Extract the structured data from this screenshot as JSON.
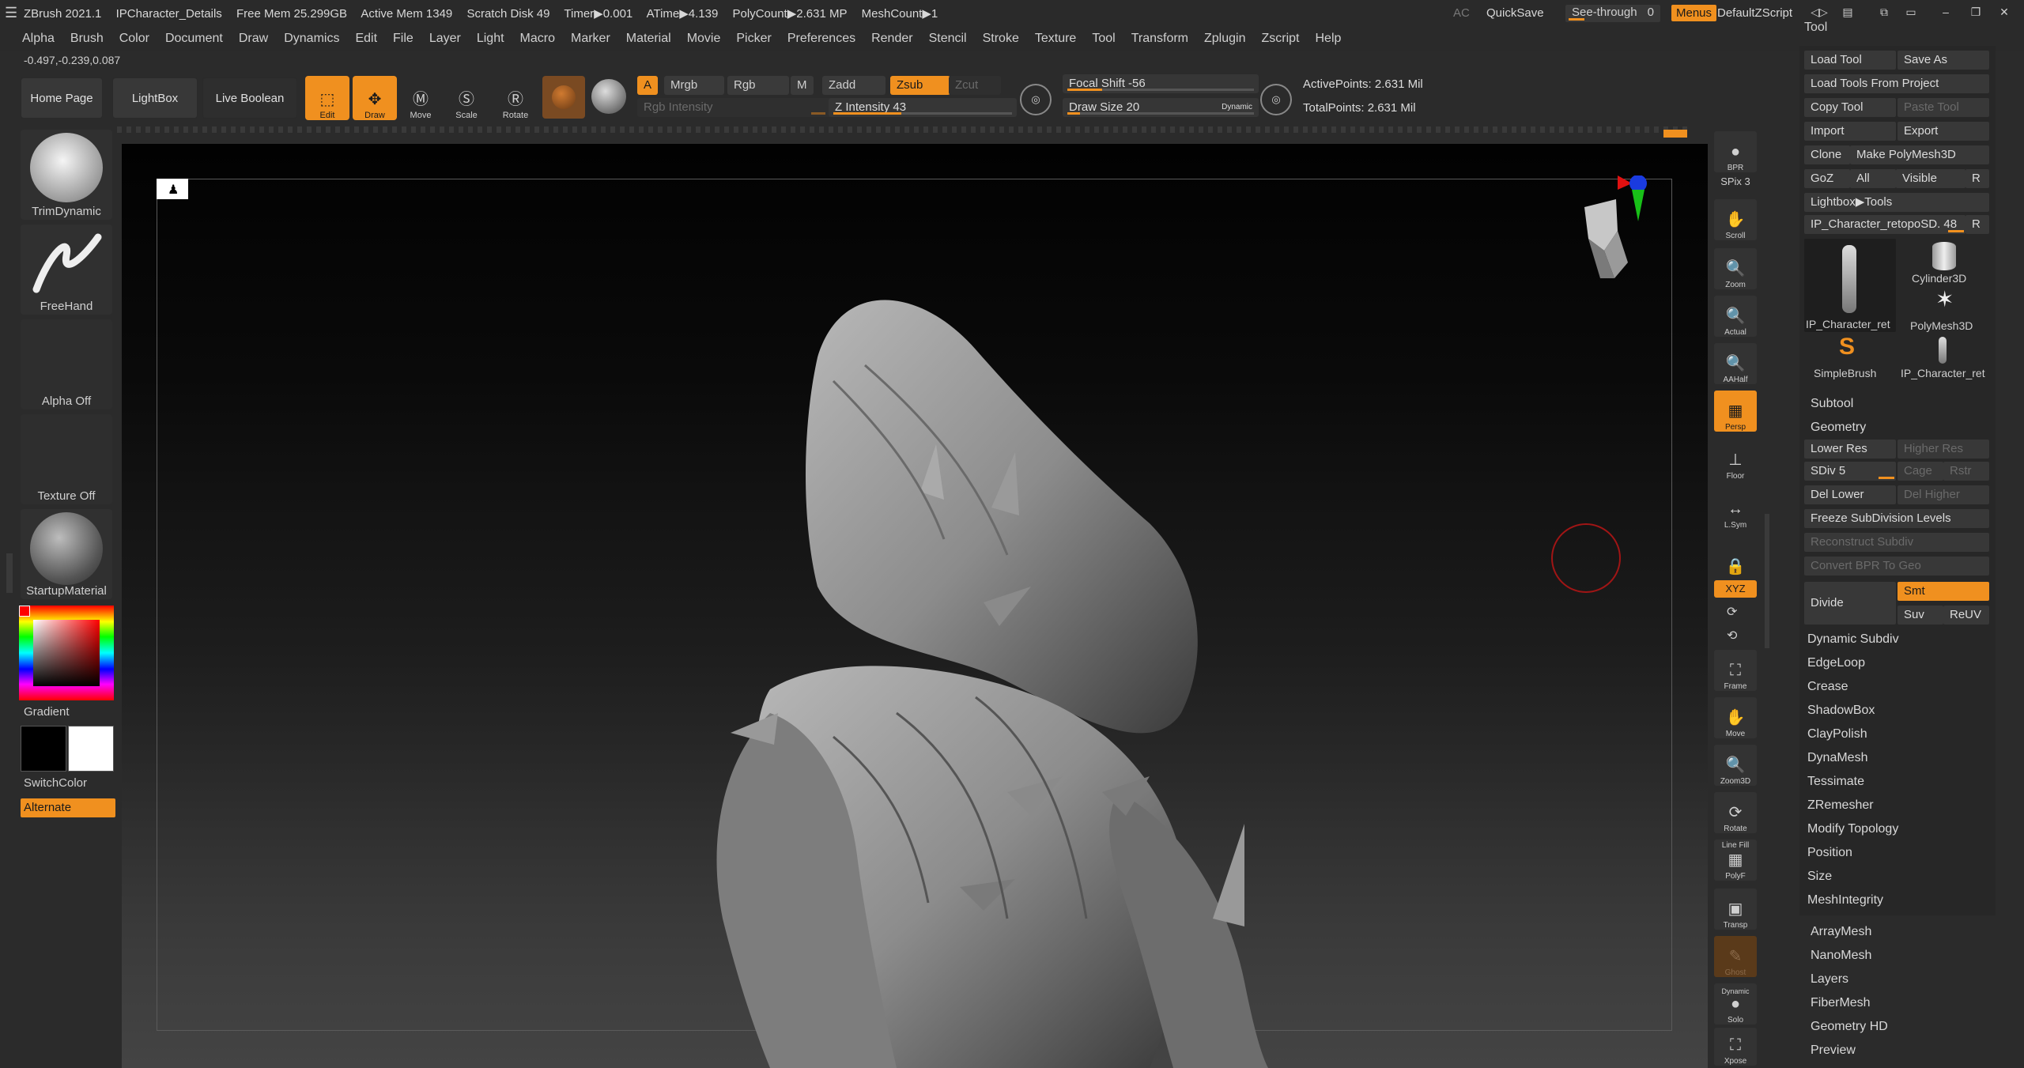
{
  "titlebar": {
    "app": "ZBrush 2021.1",
    "doc": "IPCharacter_Details",
    "free_mem": "Free Mem 25.299GB",
    "active_mem": "Active Mem 1349",
    "scratch": "Scratch Disk 49",
    "timer": "Timer▶0.001",
    "atime": "ATime▶4.139",
    "polycount": "PolyCount▶2.631 MP",
    "meshcount": "MeshCount▶1",
    "ac": "AC",
    "quicksave": "QuickSave",
    "seethrough": "See-through",
    "seethrough_value": "0",
    "menus": "Menus",
    "script": "DefaultZScript"
  },
  "menubar": [
    "Alpha",
    "Brush",
    "Color",
    "Document",
    "Draw",
    "Dynamics",
    "Edit",
    "File",
    "Layer",
    "Light",
    "Macro",
    "Marker",
    "Material",
    "Movie",
    "Picker",
    "Preferences",
    "Render",
    "Stencil",
    "Stroke",
    "Texture",
    "Tool",
    "Transform",
    "Zplugin",
    "Zscript",
    "Help"
  ],
  "coords": "-0.497,-0.239,0.087",
  "toolbar": {
    "home": "Home Page",
    "lightbox": "LightBox",
    "live_boolean": "Live Boolean",
    "edit": "Edit",
    "draw": "Draw",
    "move": "Move",
    "scale": "Scale",
    "rotate": "Rotate",
    "a": "A",
    "mrgb": "Mrgb",
    "rgb": "Rgb",
    "m": "M",
    "zadd": "Zadd",
    "zsub": "Zsub",
    "zcut": "Zcut",
    "rgb_intensity": "Rgb Intensity",
    "z_intensity": "Z Intensity 43",
    "z_intensity_value": 43,
    "focal_shift": "Focal Shift -56",
    "draw_size": "Draw Size 20",
    "dynamic": "Dynamic",
    "active_points": "ActivePoints: 2.631 Mil",
    "total_points": "TotalPoints: 2.631 Mil"
  },
  "left": {
    "brush": "TrimDynamic",
    "stroke": "FreeHand",
    "alpha": "Alpha Off",
    "texture": "Texture Off",
    "material": "StartupMaterial",
    "gradient": "Gradient",
    "switchcolor": "SwitchColor",
    "alternate": "Alternate"
  },
  "right_tools": {
    "bpr": "BPR",
    "spix": "SPix 3",
    "scroll": "Scroll",
    "zoom": "Zoom",
    "actual": "Actual",
    "aahalf": "AAHalf",
    "persp": "Persp",
    "floor": "Floor",
    "lsym": "L.Sym",
    "xyz": "XYZ",
    "frame": "Frame",
    "move": "Move",
    "zoom3d": "Zoom3D",
    "rotate": "Rotate",
    "linefill": "Line Fill",
    "polyf": "PolyF",
    "transp": "Transp",
    "ghost": "Ghost",
    "dynamic": "Dynamic",
    "solo": "Solo",
    "xpose": "Xpose"
  },
  "tool_panel": {
    "title": "Tool",
    "load_tool": "Load Tool",
    "save_as": "Save As",
    "load_from_project": "Load Tools From Project",
    "copy_tool": "Copy Tool",
    "paste_tool": "Paste Tool",
    "import": "Import",
    "export": "Export",
    "clone": "Clone",
    "make_polymesh": "Make PolyMesh3D",
    "goz": "GoZ",
    "all": "All",
    "visible": "Visible",
    "r": "R",
    "lightbox_tools": "Lightbox▶Tools",
    "current_tool": "IP_Character_retopoSD. 48",
    "thumbs": [
      "IP_Character_ret",
      "Cylinder3D",
      "PolyMesh3D",
      "SimpleBrush",
      "IP_Character_ret"
    ],
    "subtool": "Subtool",
    "geometry": "Geometry",
    "lower_res": "Lower Res",
    "higher_res": "Higher Res",
    "sdiv": "SDiv 5",
    "cage": "Cage",
    "rstr": "Rstr",
    "del_lower": "Del Lower",
    "del_higher": "Del Higher",
    "freeze": "Freeze SubDivision Levels",
    "reconstruct": "Reconstruct Subdiv",
    "convert_bpr": "Convert BPR To Geo",
    "divide": "Divide",
    "smt": "Smt",
    "suv": "Suv",
    "reuv": "ReUV",
    "geometry_items": [
      "Dynamic Subdiv",
      "EdgeLoop",
      "Crease",
      "ShadowBox",
      "ClayPolish",
      "DynaMesh",
      "Tessimate",
      "ZRemesher",
      "Modify Topology",
      "Position",
      "Size",
      "MeshIntegrity"
    ],
    "sections": [
      "ArrayMesh",
      "NanoMesh",
      "Layers",
      "FiberMesh",
      "Geometry HD",
      "Preview"
    ]
  }
}
